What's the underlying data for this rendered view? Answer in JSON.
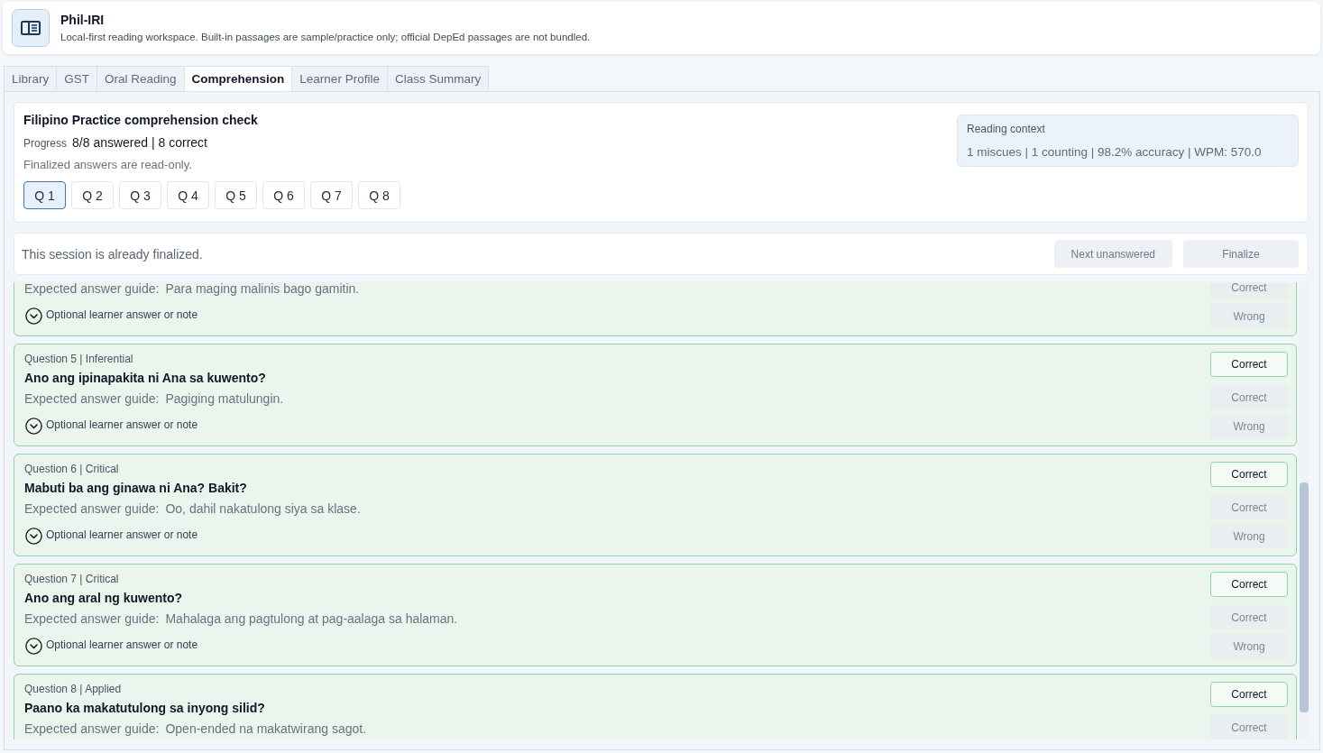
{
  "app": {
    "title": "Phil-IRI",
    "subtitle": "Local-first reading workspace. Built-in passages are sample/practice only; official DepEd passages are not bundled."
  },
  "tabs": [
    {
      "label": "Library",
      "selected": false
    },
    {
      "label": "GST",
      "selected": false
    },
    {
      "label": "Oral Reading",
      "selected": false
    },
    {
      "label": "Comprehension",
      "selected": true
    },
    {
      "label": "Learner Profile",
      "selected": false
    },
    {
      "label": "Class Summary",
      "selected": false
    }
  ],
  "summary": {
    "title": "Filipino Practice comprehension check",
    "progress_label": "Progress",
    "progress_value": "8/8 answered | 8 correct",
    "note": "Finalized answers are read-only.",
    "question_buttons": [
      {
        "label": "Q 1",
        "selected": true
      },
      {
        "label": "Q 2",
        "selected": false
      },
      {
        "label": "Q 3",
        "selected": false
      },
      {
        "label": "Q 4",
        "selected": false
      },
      {
        "label": "Q 5",
        "selected": false
      },
      {
        "label": "Q 6",
        "selected": false
      },
      {
        "label": "Q 7",
        "selected": false
      },
      {
        "label": "Q 8",
        "selected": false
      }
    ]
  },
  "reading_context": {
    "title": "Reading context",
    "stats": "1 miscues | 1 counting | 98.2% accuracy | WPM: 570.0"
  },
  "action_bar": {
    "message": "This session is already finalized.",
    "buttons": [
      {
        "label": "Next unanswered",
        "disabled": true
      },
      {
        "label": "Finalize",
        "disabled": true
      }
    ]
  },
  "questions": [
    {
      "guide_label": "Expected answer guide:",
      "guide": "Para maging malinis bago gamitin.",
      "note_toggle": {
        "label": "Optional learner answer or note",
        "expanded": false
      },
      "buttons": [
        {
          "label": "Correct",
          "disabled": true
        },
        {
          "label": "Wrong",
          "disabled": true
        }
      ]
    },
    {
      "heading": "Question 5 | Inferential",
      "question": "Ano ang ipinapakita ni Ana sa kuwento?",
      "result": "Correct",
      "guide_label": "Expected answer guide:",
      "guide": "Pagiging matulungin.",
      "note_toggle": {
        "label": "Optional learner answer or note",
        "expanded": false
      },
      "buttons": [
        {
          "label": "Correct",
          "disabled": true
        },
        {
          "label": "Wrong",
          "disabled": true
        }
      ]
    },
    {
      "heading": "Question 6 | Critical",
      "question": "Mabuti ba ang ginawa ni Ana? Bakit?",
      "result": "Correct",
      "guide_label": "Expected answer guide:",
      "guide": "Oo, dahil nakatulong siya sa klase.",
      "note_toggle": {
        "label": "Optional learner answer or note",
        "expanded": false
      },
      "buttons": [
        {
          "label": "Correct",
          "disabled": true
        },
        {
          "label": "Wrong",
          "disabled": true
        }
      ]
    },
    {
      "heading": "Question 7 | Critical",
      "question": "Ano ang aral ng kuwento?",
      "result": "Correct",
      "guide_label": "Expected answer guide:",
      "guide": "Mahalaga ang pagtulong at pag-aalaga sa halaman.",
      "note_toggle": {
        "label": "Optional learner answer or note",
        "expanded": false
      },
      "buttons": [
        {
          "label": "Correct",
          "disabled": true
        },
        {
          "label": "Wrong",
          "disabled": true
        }
      ]
    },
    {
      "heading": "Question 8 | Applied",
      "question": "Paano ka makatutulong sa inyong silid?",
      "result": "Correct",
      "guide_label": "Expected answer guide:",
      "guide": "Open-ended na makatwirang sagot.",
      "buttons": [
        {
          "label": "Correct",
          "disabled": true
        }
      ]
    }
  ]
}
